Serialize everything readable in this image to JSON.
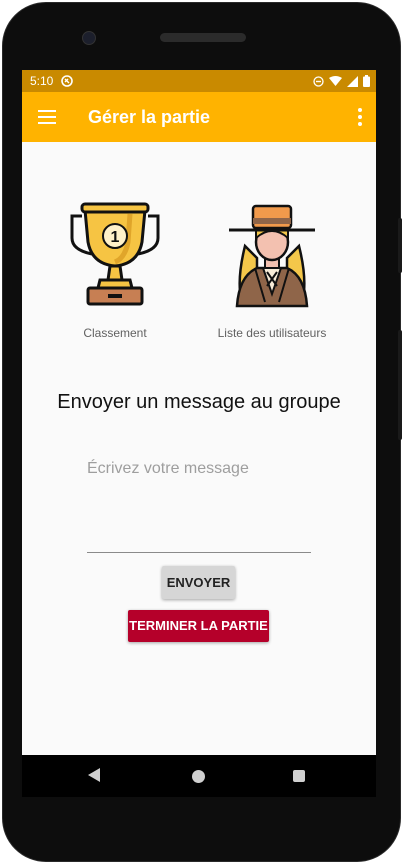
{
  "status": {
    "time": "5:10"
  },
  "appbar": {
    "title": "Gérer la partie"
  },
  "tiles": [
    {
      "label": "Classement",
      "icon": "trophy-icon"
    },
    {
      "label": "Liste des utilisateurs",
      "icon": "detective-user-icon"
    }
  ],
  "main": {
    "heading": "Envoyer un message au groupe",
    "message_placeholder": "Écrivez votre message",
    "send_label": "ENVOYER",
    "end_label": "TERMINER LA PARTIE"
  },
  "colors": {
    "appbar": "#ffb300",
    "statusbar": "#c98a00",
    "end_button": "#b5002a",
    "send_button": "#d6d6d6"
  }
}
